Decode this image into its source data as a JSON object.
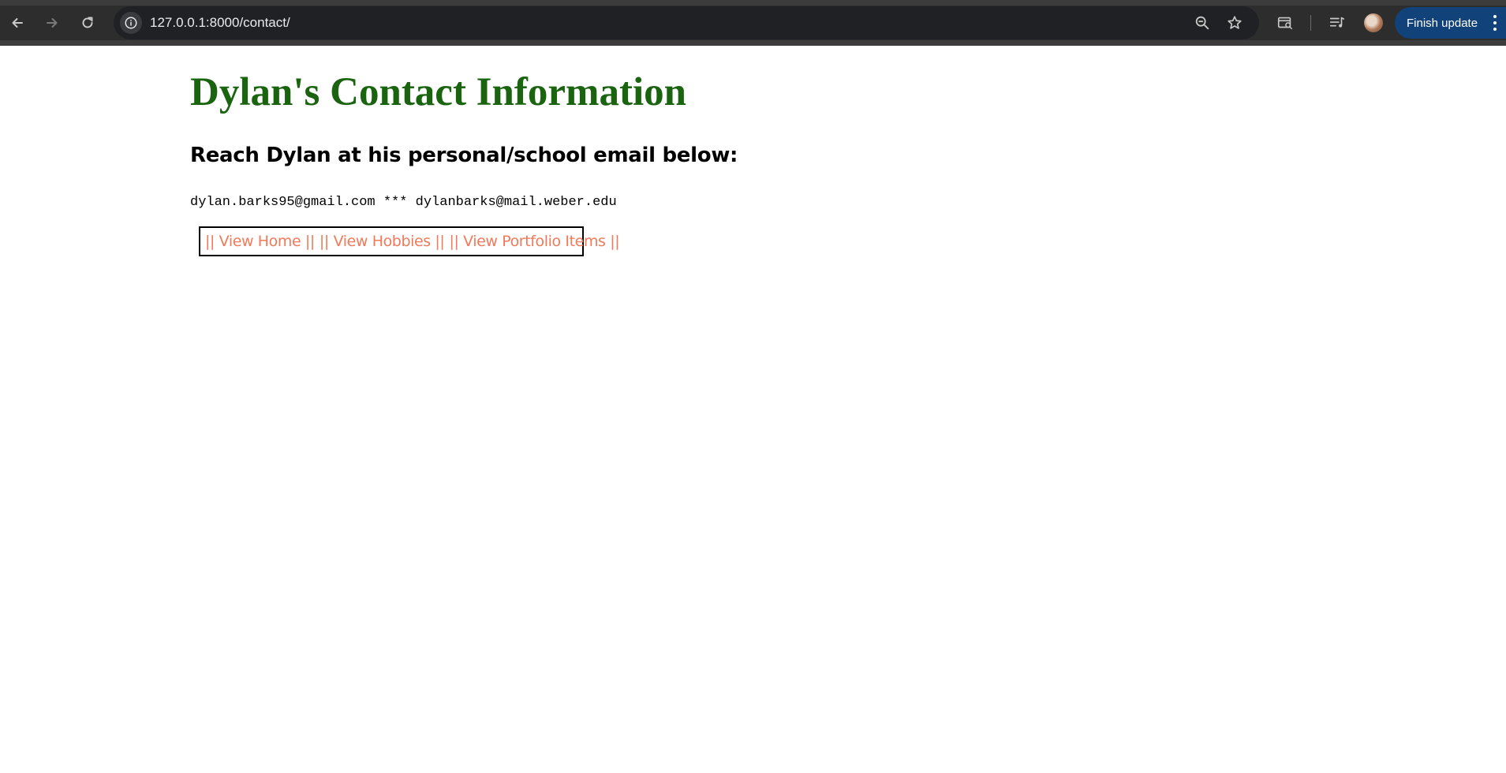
{
  "browser": {
    "url": "127.0.0.1:8000/contact/",
    "finish_update_label": "Finish update",
    "icons": [
      "back-arrow-icon",
      "forward-arrow-icon",
      "reload-icon",
      "site-info-icon",
      "zoom-out-icon",
      "bookmark-star-icon",
      "tab-search-icon",
      "reading-list-icon",
      "profile-avatar",
      "more-options-icon"
    ]
  },
  "page": {
    "title": "Dylan's Contact Information",
    "subtitle": "Reach Dylan at his personal/school email below:",
    "emails": "dylan.barks95@gmail.com *** dylanbarks@mail.weber.edu",
    "nav_links": [
      "|| View Home ||",
      "|| View Hobbies ||",
      "|| View Portfolio Items ||"
    ]
  },
  "colors": {
    "title": "#1a6410",
    "link": "#f07a5a",
    "toolbar": "#2d2d2d",
    "finish_button": "#12427a"
  }
}
